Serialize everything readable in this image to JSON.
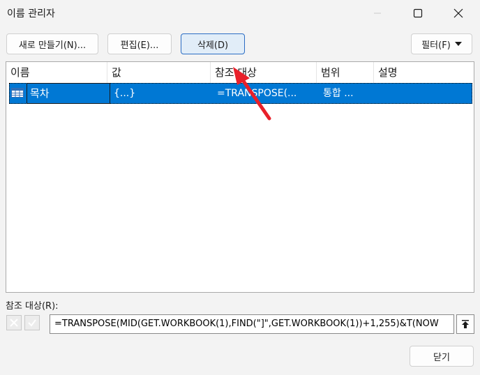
{
  "window": {
    "title": "이름 관리자"
  },
  "toolbar": {
    "new_label": "새로 만들기(N)...",
    "edit_label": "편집(E)...",
    "delete_label": "삭제(D)",
    "filter_label": "필터(F)"
  },
  "table": {
    "headers": [
      "이름",
      "값",
      "참조 대상",
      "범위",
      "설명"
    ],
    "rows": [
      {
        "name": "목차",
        "value": "{...}",
        "refers_to": "=TRANSPOSE(...",
        "scope": "통합 ...",
        "comment": ""
      }
    ]
  },
  "refers_to_field": {
    "label": "참조 대상(R):",
    "value": "=TRANSPOSE(MID(GET.WORKBOOK(1),FIND(\"]\",GET.WORKBOOK(1))+1,255)&T(NOW"
  },
  "footer": {
    "close_label": "닫기"
  },
  "colors": {
    "selection": "#0078d4",
    "primary_border": "#2a6cc4",
    "annotation_arrow": "#e8202a"
  }
}
